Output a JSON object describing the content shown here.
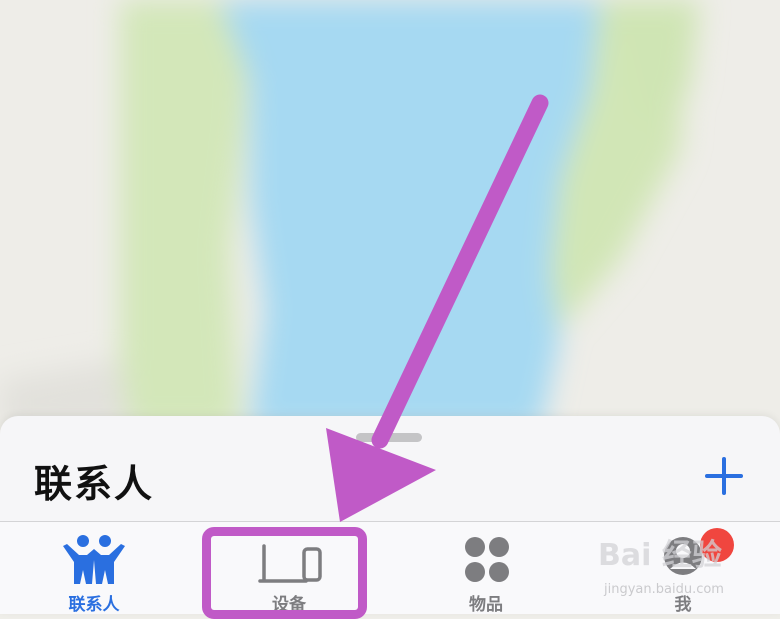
{
  "sheet": {
    "title": "联系人",
    "add_icon": "plus-icon"
  },
  "tabs": [
    {
      "label": "联系人",
      "icon": "people-icon",
      "active": true
    },
    {
      "label": "设备",
      "icon": "devices-icon",
      "active": false
    },
    {
      "label": "物品",
      "icon": "items-icon",
      "active": false
    },
    {
      "label": "我",
      "icon": "me-icon",
      "active": false
    }
  ],
  "colors": {
    "accent": "#2a6fe0",
    "annotation": "#c05ac7",
    "badge": "#f0463f",
    "water": "#a6d9f2",
    "park": "#cfe6b4"
  },
  "watermark": {
    "text": "Bai 经验",
    "sub": "jingyan.baidu.com"
  }
}
